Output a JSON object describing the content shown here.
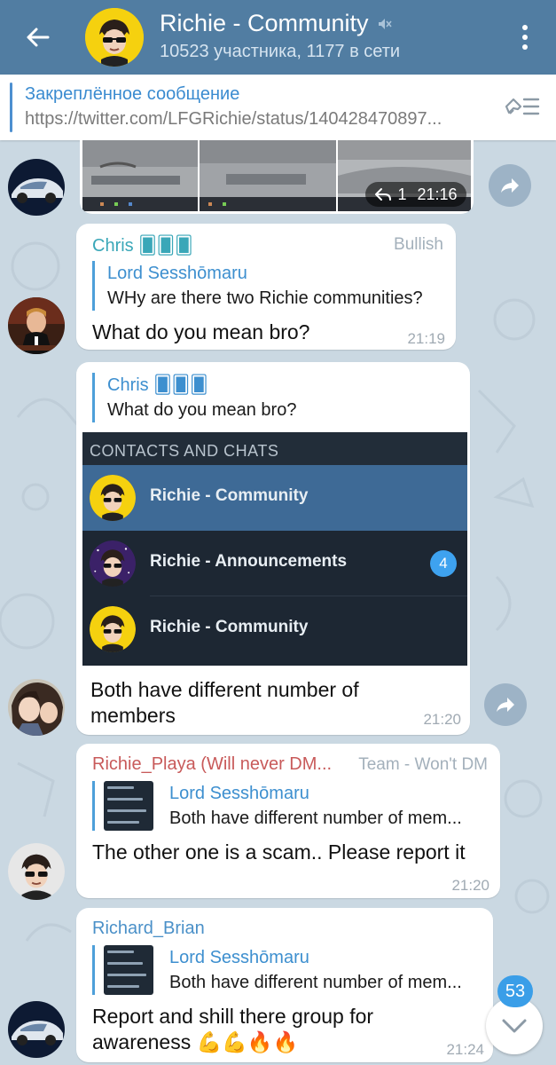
{
  "header": {
    "title": "Richie - Community",
    "subtitle": "10523 участника, 1177 в сети"
  },
  "pinned": {
    "title": "Закреплённое сообщение",
    "text": "https://twitter.com/LFGRichie/status/140428470897..."
  },
  "media_message": {
    "replies": "1",
    "time": "21:16"
  },
  "messages": [
    {
      "sender": "Chris 🂠🂠🂠",
      "badge": "Bullish",
      "reply_name": "Lord Sesshōmaru",
      "reply_text": "WHy are there two Richie communities?",
      "text": "What do you mean bro?",
      "time": "21:19"
    },
    {
      "reply_name": "Chris 🂠🂠🂠",
      "reply_text": "What do you mean bro?",
      "text": "Both have different number of members",
      "time": "21:20",
      "embed": {
        "header": "CONTACTS AND CHATS",
        "rows": [
          {
            "name": "Richie - Community",
            "count": ""
          },
          {
            "name": "Richie - Announcements",
            "count": "4"
          },
          {
            "name": "Richie - Community",
            "count": ""
          }
        ]
      }
    },
    {
      "sender": "Richie_Playa (Will never DM...",
      "badge": "Team - Won't DM",
      "reply_name": "Lord Sesshōmaru",
      "reply_text": "Both have different number of mem...",
      "text": "The other one is a scam.. Please report it",
      "time": "21:20"
    },
    {
      "sender": "Richard_Brian",
      "reply_name": "Lord Sesshōmaru",
      "reply_text": "Both have different number of mem...",
      "text": "Report and shill there group for awareness 💪💪🔥🔥",
      "time": "21:24"
    }
  ],
  "scroll_down": {
    "unread_count": "53"
  },
  "colors": {
    "header_bg": "#517da2",
    "accent": "#3a8bd0",
    "chris_name": "#3aa7b8",
    "playa_name": "#c85a5a",
    "brian_name": "#4a90c8"
  }
}
